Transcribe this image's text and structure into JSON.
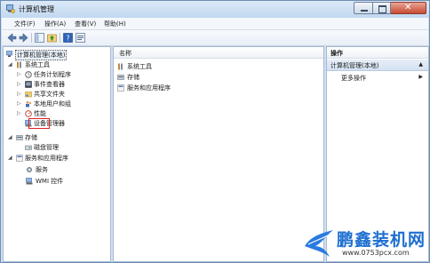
{
  "window": {
    "title": "计算机管理"
  },
  "menu": [
    "文件(F)",
    "操作(A)",
    "查看(V)",
    "帮助(H)"
  ],
  "tree": {
    "root": "计算机管理(本地)",
    "system_tools": "系统工具",
    "task_scheduler": "任务计划程序",
    "event_viewer": "事件查看器",
    "shared_folders": "共享文件夹",
    "local_users": "本地用户和组",
    "performance": "性能",
    "device_manager": "设备管理器",
    "storage": "存储",
    "disk_management": "磁盘管理",
    "services_apps": "服务和应用程序",
    "services": "服务",
    "wmi": "WMI 控件"
  },
  "list": {
    "header": "名称",
    "items": [
      "系统工具",
      "存储",
      "服务和应用程序"
    ]
  },
  "actions": {
    "header": "操作",
    "group": "计算机管理(本地)",
    "more": "更多操作"
  },
  "watermark": {
    "title": "鹏鑫装机网",
    "url": "www.0753pcx.com"
  },
  "colors": {
    "accent": "#1e6fd0",
    "highlight": "#e02020",
    "window_frame": "#cfe0f2"
  }
}
